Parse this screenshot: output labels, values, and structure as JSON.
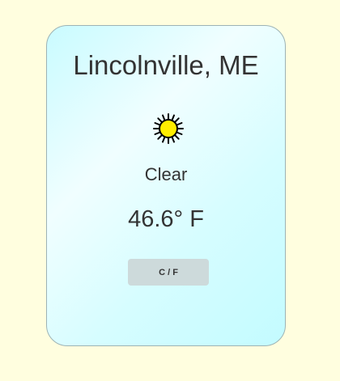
{
  "location": "Lincolnville, ME",
  "weather": {
    "icon": "sun-icon",
    "condition": "Clear",
    "temperature": "46.6° F"
  },
  "toggle": {
    "label": "C / F"
  },
  "colors": {
    "background": "#fffedf",
    "card_gradient_start": "#c9fbff",
    "card_gradient_mid": "#f0feff",
    "sun_fill": "#ffee00",
    "button_bg": "#cddadb",
    "text": "#333333"
  }
}
